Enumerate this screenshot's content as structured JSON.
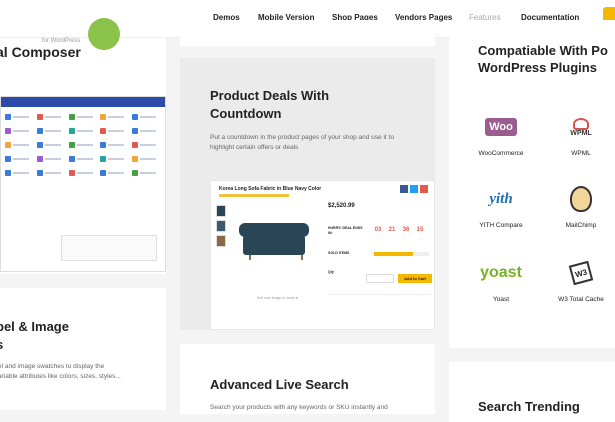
{
  "nav": {
    "items": [
      "Demos",
      "Mobile Version",
      "Shop Pages",
      "Vendors Pages",
      "Features",
      "Documentation"
    ]
  },
  "left": {
    "vc_small": "for WordPress",
    "vc_title": "al Composer",
    "swatches_title_1": "bel & Image",
    "swatches_title_2": "s",
    "swatches_desc_1": "el and image swatches to display the",
    "swatches_desc_2": "ariable attributes like colors, sizes, styles..."
  },
  "middle": {
    "countdown_title_1": "Product Deals With",
    "countdown_title_2": "Countdown",
    "countdown_desc_1": "Put a countdown in the product pages of your shop and use it to",
    "countdown_desc_2": "highlight certain offers or deals",
    "product": {
      "name": "Korea Long Sofa Fabric in Blue Navy Color",
      "price": "$2,520.99",
      "deal_text": "HURRY! DEAL ENDS IN:",
      "countdown": [
        "03",
        "21",
        "36",
        "15"
      ],
      "stock_label": "SOLD ITEMS",
      "qty_label": "Qty",
      "add_to_cart": "Add to Cart",
      "zoom_caption": "Roll over image to zoom in"
    },
    "search_title": "Advanced Live Search",
    "search_desc": "Search your products with any keywords or SKU instantly and"
  },
  "right": {
    "compat_title_1": "Compatiable With Po",
    "compat_title_2": "WordPress Plugins",
    "plugins": [
      {
        "name": "WooCommerce",
        "mark": "Woo"
      },
      {
        "name": "WPML",
        "mark": "WPML"
      },
      {
        "name": "YITH Compare",
        "mark": "yith"
      },
      {
        "name": "MailChimp",
        "mark": "chimp-icon"
      },
      {
        "name": "Yoast",
        "mark": "yoast"
      },
      {
        "name": "W3 Total Cache",
        "mark": "W3"
      }
    ],
    "search_trending": "Search Trending"
  }
}
